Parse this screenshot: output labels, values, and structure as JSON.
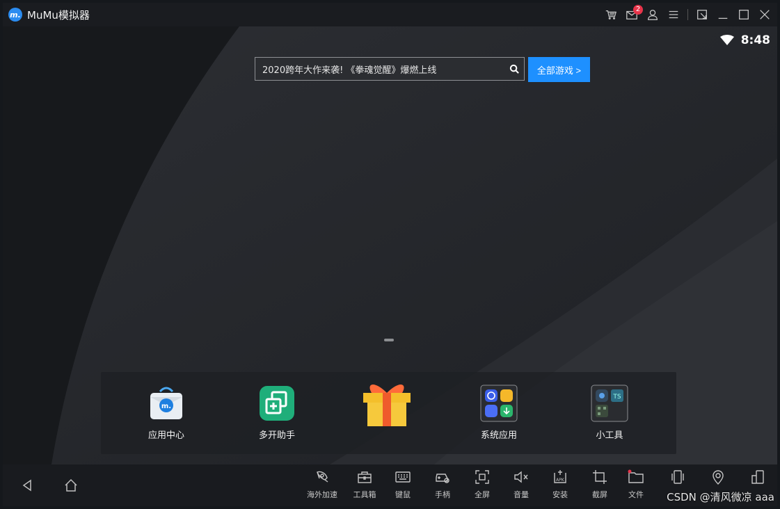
{
  "window": {
    "app_title": "MuMu模拟器",
    "logo_glyph": "m.",
    "mail_badge_count": "2",
    "icons": [
      "shop-icon",
      "mail-icon",
      "user-icon",
      "menu-icon",
      "sync-icon",
      "minimize-icon",
      "maximize-icon",
      "close-icon"
    ]
  },
  "status_bar": {
    "time": "8:48",
    "wifi": "wifi-icon"
  },
  "search": {
    "text": "2020跨年大作来袭! 《拳魂觉醒》爆燃上线",
    "button_label": "全部游戏 >"
  },
  "dock": {
    "items": [
      {
        "label": "应用中心",
        "icon": "app-center-icon"
      },
      {
        "label": "多开助手",
        "icon": "multi-instance-icon"
      },
      {
        "label": "",
        "icon": "gift-icon"
      },
      {
        "label": "系统应用",
        "icon": "system-apps-folder-icon"
      },
      {
        "label": "小工具",
        "icon": "tools-folder-icon"
      }
    ]
  },
  "toolbar": {
    "items": [
      {
        "label": "海外加速",
        "icon": "rocket-icon"
      },
      {
        "label": "工具箱",
        "icon": "toolbox-icon"
      },
      {
        "label": "键鼠",
        "icon": "keyboard-icon"
      },
      {
        "label": "手柄",
        "icon": "gamepad-icon"
      },
      {
        "label": "全屏",
        "icon": "fullscreen-icon"
      },
      {
        "label": "音量",
        "icon": "volume-icon"
      },
      {
        "label": "安装",
        "icon": "apk-install-icon"
      },
      {
        "label": "截屏",
        "icon": "crop-icon"
      },
      {
        "label": "文件",
        "icon": "folder-icon"
      },
      {
        "label": "",
        "icon": "rotate-icon"
      },
      {
        "label": "",
        "icon": "location-icon"
      },
      {
        "label": "",
        "icon": "multi-window-icon"
      }
    ]
  },
  "watermark": "CSDN @清风微凉 aaa",
  "colors": {
    "accent": "#1e90ff",
    "badge": "#e8344a",
    "titlebar": "#1a1c20"
  }
}
